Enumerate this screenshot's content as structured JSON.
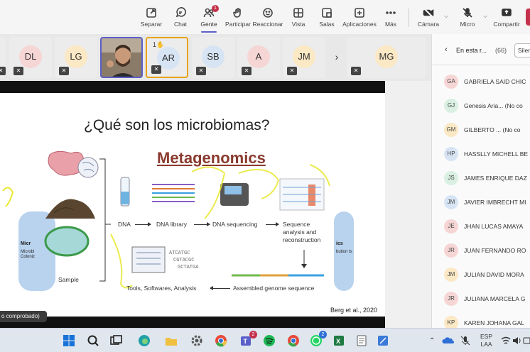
{
  "toolbar": {
    "items": [
      {
        "label": "Separar",
        "icon": "pop-out-icon"
      },
      {
        "label": "Chat",
        "icon": "chat-icon"
      },
      {
        "label": "Gente",
        "icon": "people-icon",
        "badge": "1"
      },
      {
        "label": "Participar",
        "icon": "raise-hand-icon"
      },
      {
        "label": "Reaccionar",
        "icon": "react-icon"
      },
      {
        "label": "Vista",
        "icon": "view-icon"
      },
      {
        "label": "Salas",
        "icon": "rooms-icon"
      },
      {
        "label": "Aplicaciones",
        "icon": "apps-icon"
      },
      {
        "label": "Más",
        "icon": "more-icon"
      }
    ],
    "camera": "Cámara",
    "mic": "Micro",
    "share": "Compartir"
  },
  "strip": {
    "tiles": [
      {
        "initials": "DL",
        "color": "#f6d5d5"
      },
      {
        "initials": "LG",
        "color": "#fbe8c4"
      },
      {
        "initials": "",
        "color": "#7a6a5a"
      },
      {
        "initials": "AR",
        "color": "#d7e4f4",
        "hand": "1"
      },
      {
        "initials": "SB",
        "color": "#d7e4f4"
      },
      {
        "initials": "A",
        "color": "#f6d5d5"
      },
      {
        "initials": "JM",
        "color": "#fbe8c4"
      }
    ],
    "extra": {
      "initials": "MG",
      "color": "#fbe8c4"
    }
  },
  "slide": {
    "title": "¿Qué son los microbiomas?",
    "subtitle": "Metagenomics",
    "sample": "Sample",
    "dna": "DNA",
    "library": "DNA library",
    "sequencing": "DNA sequencing",
    "analysis": "Sequence analysis and reconstruction",
    "assembled": "Assembled genome sequence",
    "tools": "Tools, Softwares, Analysis",
    "left_head": "Micr",
    "left_sub": "Microbi Coloniz",
    "right_head": "ics",
    "right_sub": "bution ts",
    "citation": "Berg et al., 2020",
    "caption": "o comprobado)"
  },
  "panel": {
    "title": "En esta r...",
    "count": "(66)",
    "mute": "Silen",
    "people": [
      {
        "initials": "GA",
        "name": "GABRIELA SAID CHIC",
        "color": "#f6d5d5"
      },
      {
        "initials": "GJ",
        "name": "Genesis Aria... (No co",
        "color": "#d9f0e3"
      },
      {
        "initials": "GM",
        "name": "GILBERTO ... (No co",
        "color": "#fbe8c4"
      },
      {
        "initials": "HP",
        "name": "HASSLLY MICHELL BE",
        "color": "#d7e4f4"
      },
      {
        "initials": "JS",
        "name": "JAMES ENRIQUE DAZ",
        "color": "#d9f0e3"
      },
      {
        "initials": "JM",
        "name": "JAVIER IMBRECHT MI",
        "color": "#d7e4f4"
      },
      {
        "initials": "JE",
        "name": "JHAN LUCAS AMAYA",
        "color": "#f6d5d5"
      },
      {
        "initials": "JR",
        "name": "JUAN FERNANDO RO",
        "color": "#f6d5d5"
      },
      {
        "initials": "JM",
        "name": "JULIAN DAVID MORA",
        "color": "#fbe8c4"
      },
      {
        "initials": "JR",
        "name": "JULIANA MARCELA G",
        "color": "#f6d5d5"
      },
      {
        "initials": "KP",
        "name": "KAREN JOHANA GAL",
        "color": "#fbe8c4"
      }
    ]
  },
  "taskbar": {
    "lang": "ESP",
    "region": "LAA",
    "badge_teams": "2",
    "badge_whatsapp": "2"
  }
}
